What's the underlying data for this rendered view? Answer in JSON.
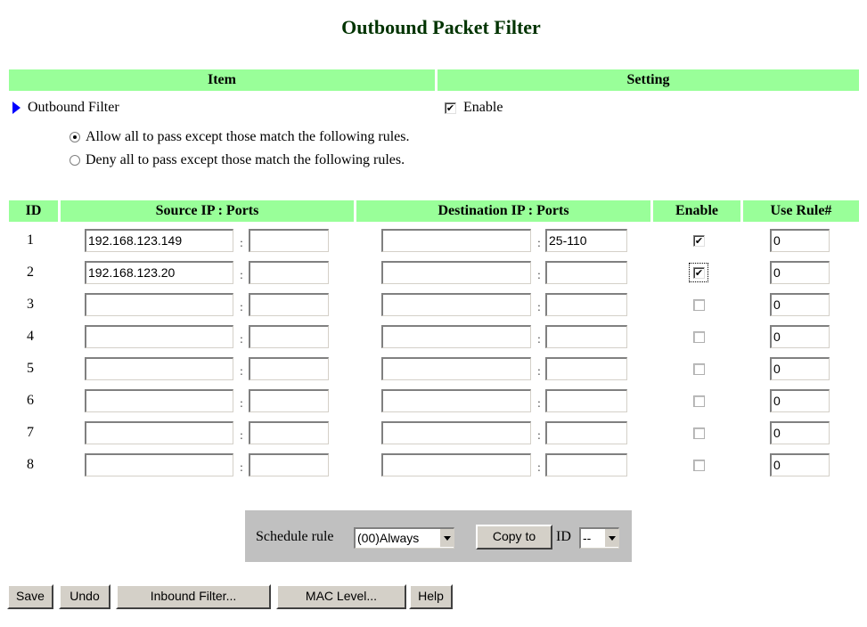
{
  "page": {
    "title": "Outbound Packet Filter"
  },
  "header": {
    "item": "Item",
    "setting": "Setting"
  },
  "outbound_filter": {
    "label": "Outbound Filter",
    "enable_label": "Enable",
    "enabled": true,
    "options": [
      {
        "label": "Allow all to pass except those match the following rules.",
        "selected": true
      },
      {
        "label": "Deny all to pass except those match the following rules.",
        "selected": false
      }
    ]
  },
  "rules_table": {
    "columns": [
      "ID",
      "Source IP : Ports",
      "Destination IP : Ports",
      "Enable",
      "Use Rule#"
    ],
    "rows": [
      {
        "id": "1",
        "src_ip": "192.168.123.149",
        "src_ports": "",
        "dst_ip": "",
        "dst_ports": "25-110",
        "enabled": true,
        "use_rule": "0"
      },
      {
        "id": "2",
        "src_ip": "192.168.123.20",
        "src_ports": "",
        "dst_ip": "",
        "dst_ports": "",
        "enabled": true,
        "use_rule": "0"
      },
      {
        "id": "3",
        "src_ip": "",
        "src_ports": "",
        "dst_ip": "",
        "dst_ports": "",
        "enabled": false,
        "use_rule": "0"
      },
      {
        "id": "4",
        "src_ip": "",
        "src_ports": "",
        "dst_ip": "",
        "dst_ports": "",
        "enabled": false,
        "use_rule": "0"
      },
      {
        "id": "5",
        "src_ip": "",
        "src_ports": "",
        "dst_ip": "",
        "dst_ports": "",
        "enabled": false,
        "use_rule": "0"
      },
      {
        "id": "6",
        "src_ip": "",
        "src_ports": "",
        "dst_ip": "",
        "dst_ports": "",
        "enabled": false,
        "use_rule": "0"
      },
      {
        "id": "7",
        "src_ip": "",
        "src_ports": "",
        "dst_ip": "",
        "dst_ports": "",
        "enabled": false,
        "use_rule": "0"
      },
      {
        "id": "8",
        "src_ip": "",
        "src_ports": "",
        "dst_ip": "",
        "dst_ports": "",
        "enabled": false,
        "use_rule": "0"
      }
    ]
  },
  "schedule": {
    "label": "Schedule rule",
    "selected": "(00)Always",
    "copy_button": "Copy to",
    "id_label": "ID",
    "id_selected": "--"
  },
  "buttons": {
    "save": "Save",
    "undo": "Undo",
    "inbound": "Inbound Filter...",
    "mac": "MAC Level...",
    "help": "Help"
  },
  "colors": {
    "header_bg": "#99ff99",
    "title": "#003300",
    "arrow": "#0000ff",
    "schedule_bg": "#c0c0c0"
  },
  "icons": {
    "bullet": "blue-triangle-arrow-icon",
    "check": "checkmark-icon"
  }
}
